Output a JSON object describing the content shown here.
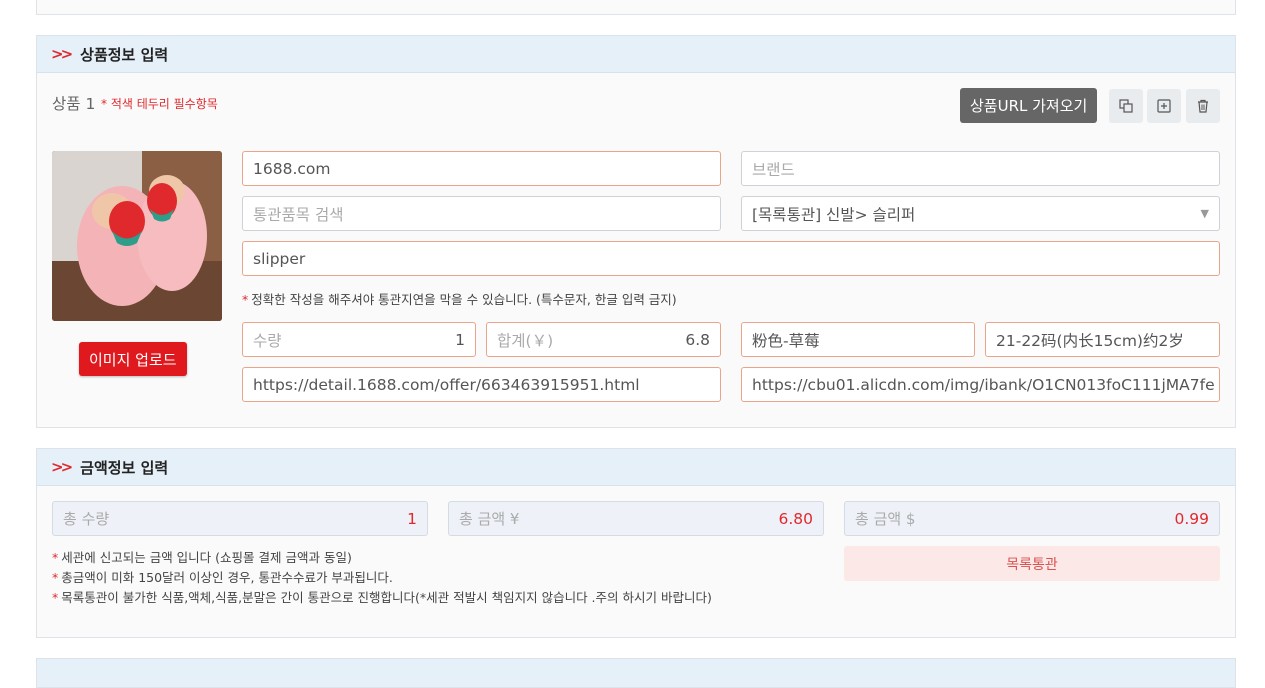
{
  "product_section": {
    "title": "상품정보 입력",
    "item_label": "상품 1",
    "required_note": "* 적색 테두리 필수항목",
    "fetch_url_button": "상품URL 가져오기",
    "upload_button": "이미지 업로드",
    "fields": {
      "site": "1688.com",
      "brand_placeholder": "브랜드",
      "customs_search_placeholder": "통관품목 검색",
      "customs_category": "[목록통관] 신발> 슬리퍼",
      "product_name": "slipper",
      "qty_label": "수량",
      "qty_value": "1",
      "total_label": "합계(￥)",
      "total_value": "6.8",
      "color_option": "粉色-草莓",
      "size_option": "21-22码(内长15cm)约2岁",
      "product_url": "https://detail.1688.com/offer/663463915951.html",
      "image_url": "https://cbu01.alicdn.com/img/ibank/O1CN013foC111jMA7fe"
    },
    "warning": "정확한 작성을 해주셔야 통관지연을 막을 수 있습니다. (특수문자, 한글 입력 금지)"
  },
  "amount_section": {
    "title": "금액정보 입력",
    "total_qty_label": "총 수량",
    "total_qty_value": "1",
    "total_yuan_label": "총 금액 ¥",
    "total_yuan_value": "6.80",
    "total_usd_label": "총 금액 $",
    "total_usd_value": "0.99",
    "customs_type_badge": "목록통관",
    "notes": [
      "세관에 신고되는 금액 입니다 (쇼핑몰 결제 금액과 동일)",
      "총금액이 미화 150달러 이상인 경우, 통관수수료가 부과됩니다.",
      "목록통관이 불가한 식품,액체,식품,분말은 간이 통관으로 진행합니다(*세관 적발시 책임지지 않습니다 .주의 하시기 바랍니다)"
    ]
  },
  "colors": {
    "accent_red": "#e0292d",
    "header_blue": "#e6f0f8",
    "required_border": "#e8a58a"
  }
}
